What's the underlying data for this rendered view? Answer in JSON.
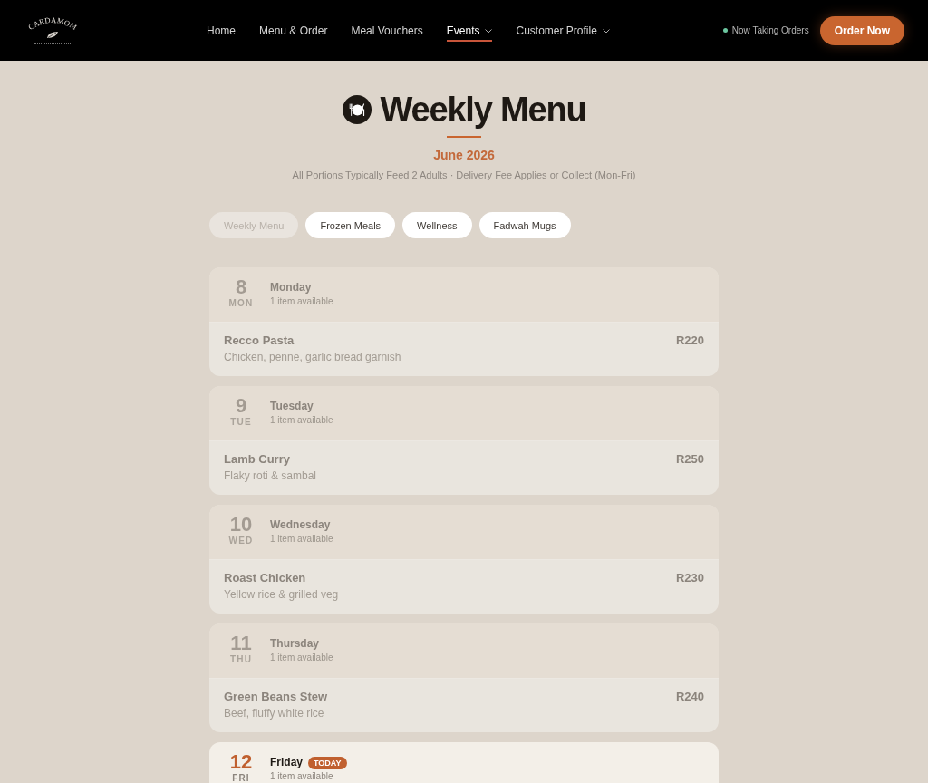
{
  "brand": {
    "name": "CARDAMOM"
  },
  "nav": {
    "links": [
      {
        "label": "Home",
        "selected": false,
        "dropdown": false
      },
      {
        "label": "Menu & Order",
        "selected": false,
        "dropdown": false
      },
      {
        "label": "Meal Vouchers",
        "selected": false,
        "dropdown": false
      },
      {
        "label": "Events",
        "selected": true,
        "dropdown": true
      },
      {
        "label": "Customer Profile",
        "selected": false,
        "dropdown": true
      }
    ],
    "status": "Now Taking Orders",
    "cta": "Order Now"
  },
  "header": {
    "title": "Weekly Menu",
    "month": "June 2026",
    "subtitle": "All Portions Typically Feed 2 Adults · Delivery Fee Applies or Collect (Mon-Fri)"
  },
  "tabs": [
    {
      "label": "Weekly Menu",
      "selected": true
    },
    {
      "label": "Frozen Meals",
      "selected": false
    },
    {
      "label": "Wellness",
      "selected": false
    },
    {
      "label": "Fadwah Mugs",
      "selected": false
    }
  ],
  "days": [
    {
      "date": "8",
      "weekday_short": "MON",
      "weekday": "Monday",
      "availability": "1 item available",
      "past": true,
      "items": [
        {
          "name": "Recco Pasta",
          "description": "Chicken, penne, garlic bread garnish",
          "price": "R220"
        }
      ]
    },
    {
      "date": "9",
      "weekday_short": "TUE",
      "weekday": "Tuesday",
      "availability": "1 item available",
      "past": true,
      "items": [
        {
          "name": "Lamb Curry",
          "description": "Flaky roti & sambal",
          "price": "R250"
        }
      ]
    },
    {
      "date": "10",
      "weekday_short": "WED",
      "weekday": "Wednesday",
      "availability": "1 item available",
      "past": true,
      "items": [
        {
          "name": "Roast Chicken",
          "description": "Yellow rice & grilled veg",
          "price": "R230"
        }
      ]
    },
    {
      "date": "11",
      "weekday_short": "THU",
      "weekday": "Thursday",
      "availability": "1 item available",
      "past": true,
      "items": [
        {
          "name": "Green Beans Stew",
          "description": "Beef, fluffy white rice",
          "price": "R240"
        }
      ]
    },
    {
      "date": "12",
      "weekday_short": "FRI",
      "weekday": "Friday",
      "badge": "TODAY",
      "availability": "1 item available",
      "past": false
    }
  ]
}
